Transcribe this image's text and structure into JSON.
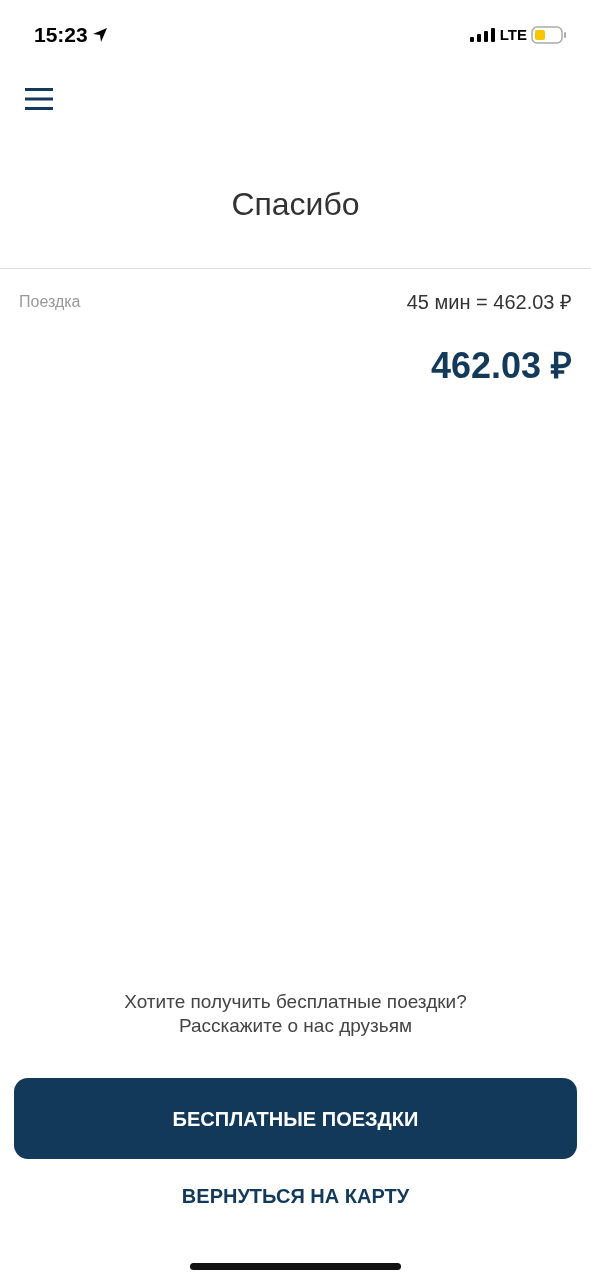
{
  "status_bar": {
    "time": "15:23",
    "network": "LTE"
  },
  "title": "Спасибо",
  "trip": {
    "label": "Поездка",
    "calculation": "45 мин = 462.03 ₽"
  },
  "total": "462.03 ₽",
  "promo": {
    "line_1": "Хотите получить бесплатные поездки?",
    "line_2": "Расскажите о нас друзьям"
  },
  "buttons": [
    {
      "kind": "primary",
      "label": "БЕСПЛАТНЫЕ ПОЕЗДКИ"
    },
    {
      "kind": "link",
      "label": "ВЕРНУТЬСЯ НА КАРТУ"
    }
  ]
}
